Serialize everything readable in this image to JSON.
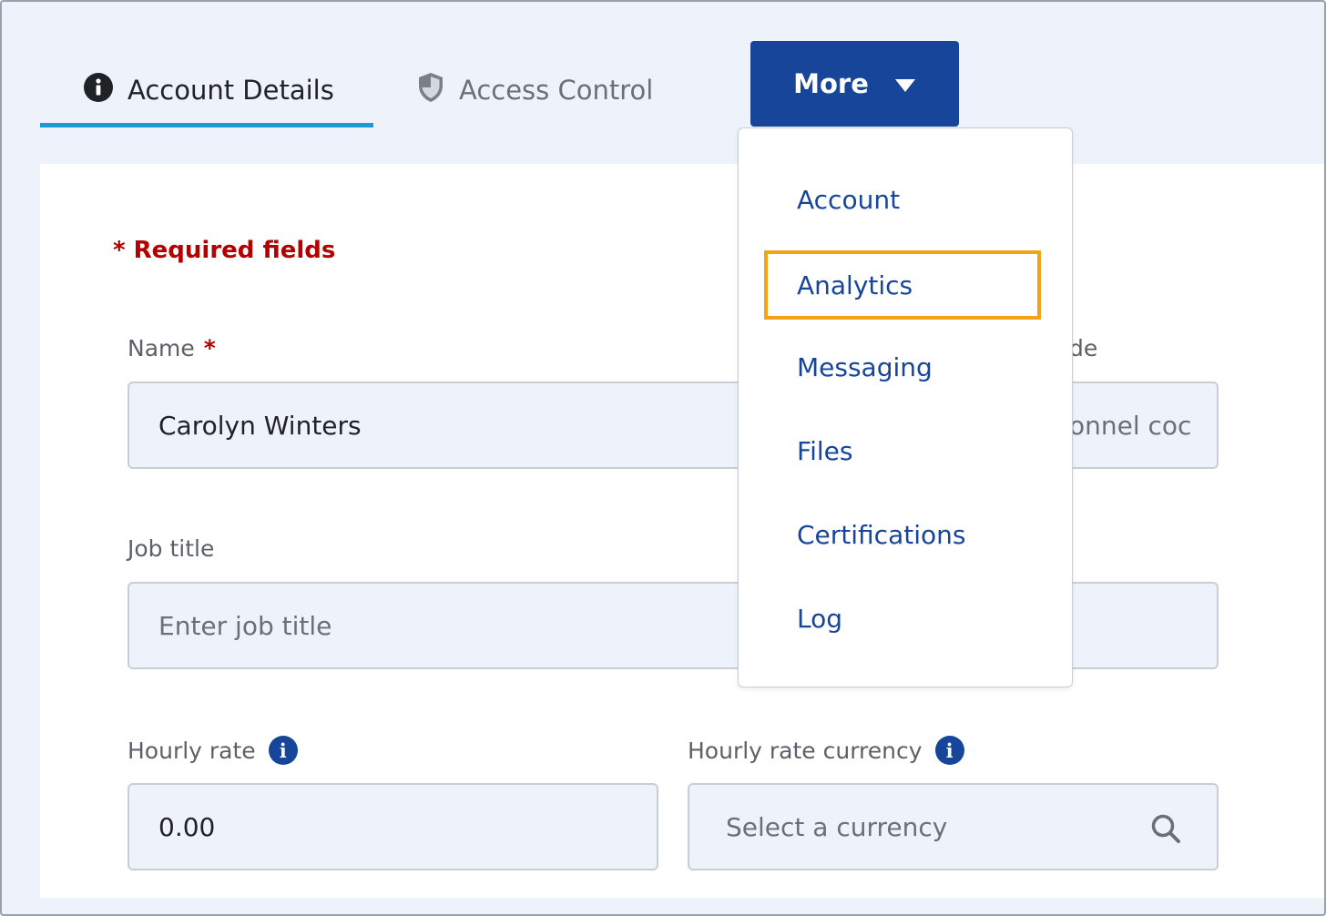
{
  "tabs": [
    {
      "label": "Account Details",
      "icon": "info-circle-icon",
      "active": true
    },
    {
      "label": "Access Control",
      "icon": "shield-icon",
      "active": false
    }
  ],
  "more": {
    "label": "More",
    "icon": "caret-down-icon"
  },
  "menu": {
    "items": [
      "Account",
      "Analytics",
      "Messaging",
      "Files",
      "Certifications",
      "Log"
    ],
    "focused_index": 1,
    "focus_color": "#f5a316"
  },
  "form": {
    "required_note": "* Required fields",
    "name": {
      "label": "Name",
      "required_mark": "*",
      "value": "Carolyn Winters"
    },
    "personnel_code": {
      "label_fragment": "de",
      "placeholder_fragment": "onnel coc"
    },
    "job_title": {
      "label": "Job title",
      "placeholder": "Enter job title"
    },
    "hourly_rate": {
      "label": "Hourly rate",
      "value": "0.00"
    },
    "hourly_rate_currency": {
      "label": "Hourly rate currency",
      "placeholder": "Select a currency"
    }
  },
  "colors": {
    "primary": "#16459a",
    "active_tab_underline": "#1a9bd7",
    "required": "#b30000",
    "background": "#eef3fb"
  }
}
